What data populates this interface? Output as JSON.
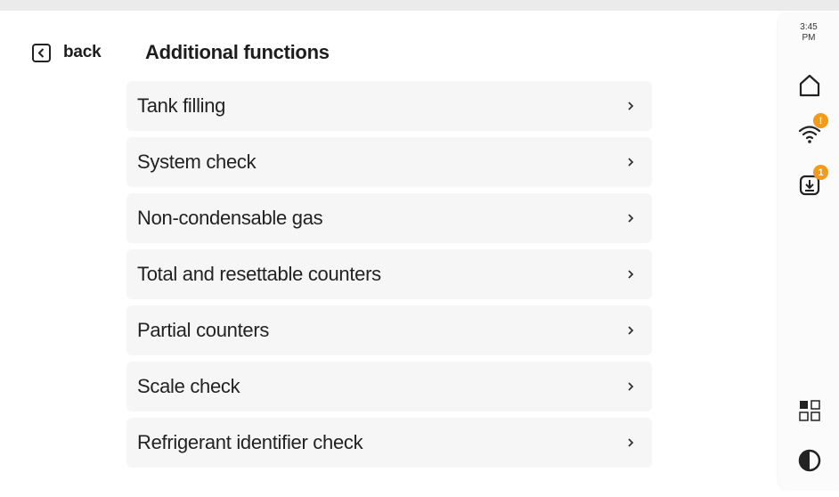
{
  "header": {
    "back_label": "back",
    "title": "Additional functions"
  },
  "menu": {
    "items": [
      {
        "label": "Tank filling"
      },
      {
        "label": "System check"
      },
      {
        "label": "Non-condensable gas"
      },
      {
        "label": "Total and resettable counters"
      },
      {
        "label": "Partial counters"
      },
      {
        "label": "Scale check"
      },
      {
        "label": "Refrigerant identifier check"
      }
    ]
  },
  "sidebar": {
    "time": "3:45",
    "ampm": "PM",
    "wifi_badge": "!",
    "download_badge": "1",
    "icons": [
      "home-icon",
      "wifi-icon",
      "download-icon",
      "apps-grid-icon",
      "contrast-icon"
    ]
  },
  "colors": {
    "badge": "#f29a1a",
    "item_background": "#f6f6f6",
    "page_background": "#ffffff"
  }
}
